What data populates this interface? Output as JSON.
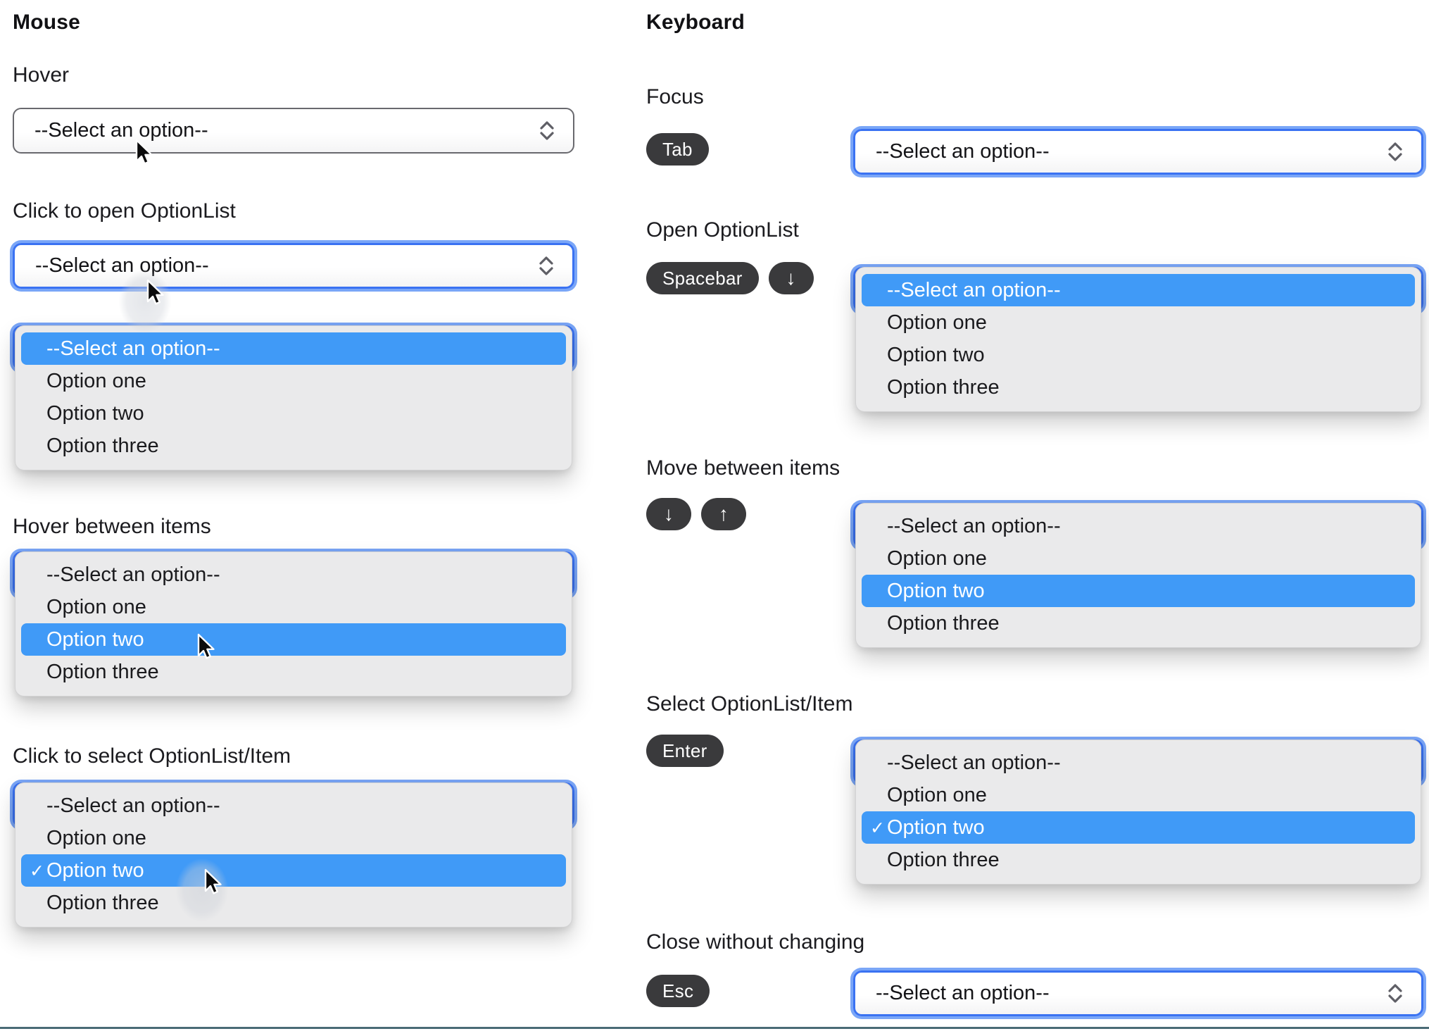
{
  "colors": {
    "highlight_blue": "#409af7",
    "focus_ring_inner": "#3a72f2",
    "focus_ring_outer": "#7aa6f7",
    "select_border_gray": "#69696e",
    "listbox_bg": "#eaeaeb",
    "key_pill_bg": "#3a3a3c",
    "bottom_rule": "#4a6b76"
  },
  "optionlist": {
    "placeholder": "--Select an option--",
    "options": [
      "--Select an option--",
      "Option one",
      "Option two",
      "Option three"
    ],
    "selected_option": "Option two",
    "checkmark": "✓"
  },
  "mouse": {
    "heading": "Mouse",
    "hover_label": "Hover",
    "click_open_label": "Click to open OptionList",
    "hover_items_label": "Hover between items",
    "click_select_label": "Click to select OptionList/Item"
  },
  "keyboard": {
    "heading": "Keyboard",
    "focus_label": "Focus",
    "open_label": "Open OptionList",
    "move_label": "Move between items",
    "select_label": "Select OptionList/Item",
    "close_label": "Close without changing",
    "keys": {
      "tab": "Tab",
      "spacebar": "Spacebar",
      "down": "↓",
      "up": "↑",
      "enter": "Enter",
      "esc": "Esc"
    }
  }
}
